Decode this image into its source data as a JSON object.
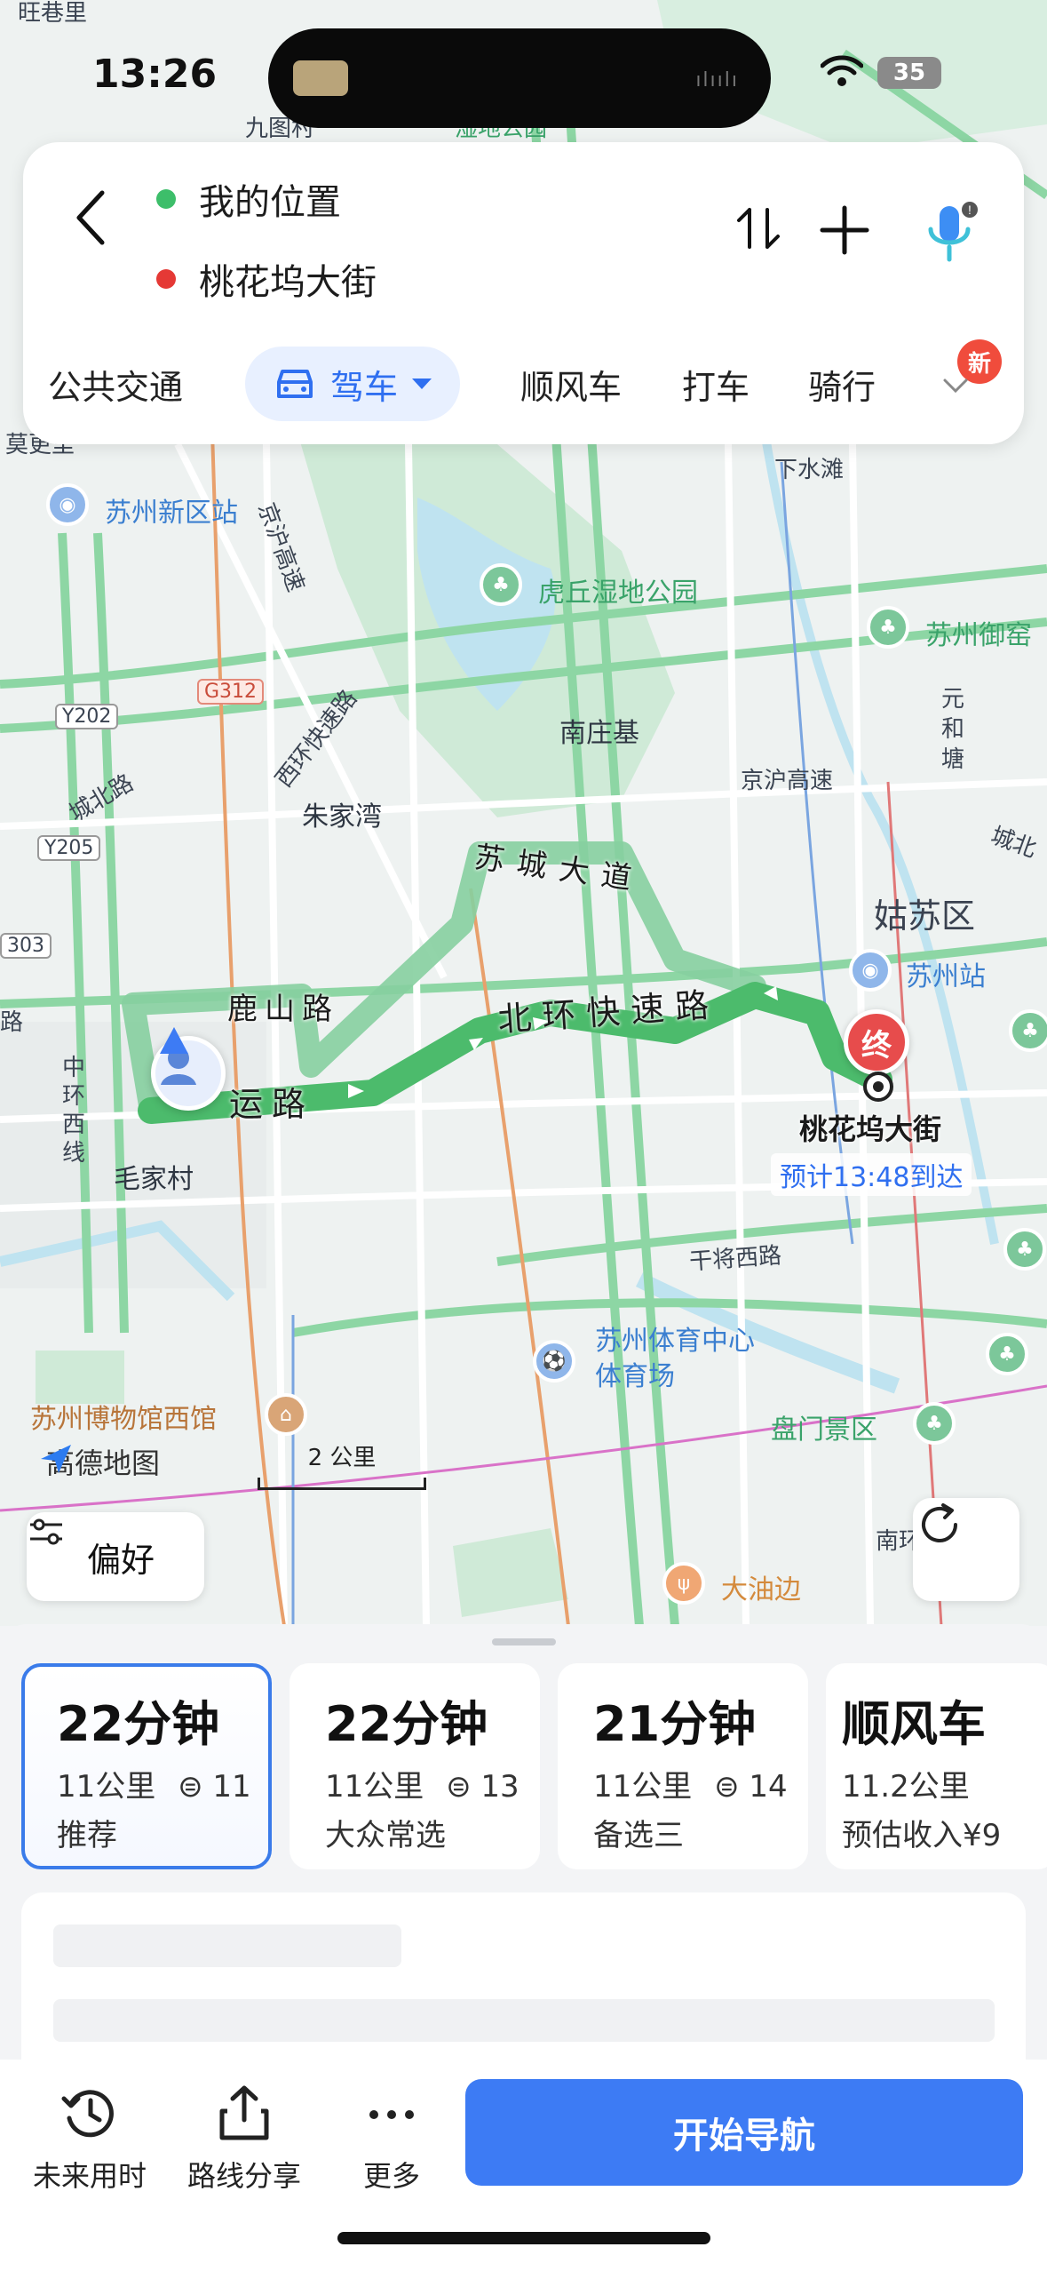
{
  "status": {
    "time": "13:26",
    "battery": "35"
  },
  "route": {
    "origin": "我的位置",
    "destination": "桃花坞大街",
    "origin_color": "#3dbe6a",
    "destination_color": "#e53935"
  },
  "modes": {
    "items": [
      "公共交通",
      "驾车",
      "顺风车",
      "打车",
      "骑行"
    ],
    "active": "驾车",
    "badge": "新"
  },
  "map": {
    "labels": {
      "wangxiang": "旺巷里",
      "jiutu": "九图村",
      "shidi": "湿地公园",
      "mozhen": "莫更里",
      "xiashui": "下水滩",
      "xinqu_station": "苏州新区站",
      "jinghu": "京沪高速",
      "huqiu": "虎丘湿地公园",
      "suzhou_yu": "苏州御窑",
      "g312": "G312",
      "y202": "Y202",
      "y205": "Y205",
      "road303": "303",
      "xifang": "西环快速路",
      "chengbei": "城北路",
      "nanzhuangji": "南庄基",
      "jinghu2": "京沪高速",
      "yuanhetang": "元和塘",
      "chengbei2": "城北",
      "zhujiawan": "朱家湾",
      "suchengdadao": "苏城大道",
      "gusu": "姑苏区",
      "suzhou_station": "苏州站",
      "lushan": "鹿山路",
      "beihuan": "北环快速路",
      "yunlu": "运路",
      "zhonghuan": "中环西线",
      "maojiacun": "毛家村",
      "ganjiang": "干将西路",
      "tiyu": "苏州体育中心体育场",
      "museum": "苏州博物馆西馆",
      "panmen": "盘门景区",
      "dayoubian": "大油边",
      "nanhuan": "南环",
      "lu_left": "路",
      "end_marker": "终"
    },
    "destination_label": "桃花坞大街",
    "eta": "预计13:48到达",
    "brand": "高德地图",
    "scale": "2 公里",
    "preference_btn": "偏好"
  },
  "route_options": [
    {
      "time": "22分钟",
      "distance": "11公里",
      "lights": "11",
      "tag": "推荐",
      "selected": true
    },
    {
      "time": "22分钟",
      "distance": "11公里",
      "lights": "13",
      "tag": "大众常选",
      "selected": false
    },
    {
      "time": "21分钟",
      "distance": "11公里",
      "lights": "14",
      "tag": "备选三",
      "selected": false
    },
    {
      "time": "顺风车",
      "distance": "11.2公里",
      "lights": "",
      "tag": "预估收入¥9",
      "selected": false
    }
  ],
  "actions": {
    "future": "未来用时",
    "share": "路线分享",
    "more": "更多",
    "start": "开始导航"
  },
  "colors": {
    "accent": "#3d7bf4",
    "route_main": "#4cbb6c",
    "route_alt": "#86cfa0"
  }
}
